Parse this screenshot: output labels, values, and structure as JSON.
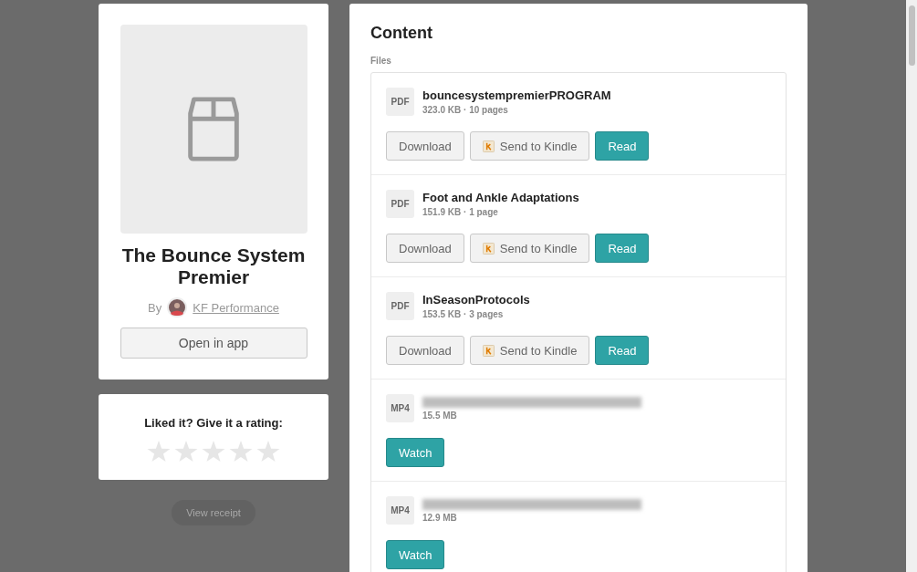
{
  "product": {
    "title": "The Bounce System Premier",
    "by_label": "By",
    "author": "KF Performance",
    "open_button": "Open in app"
  },
  "rating": {
    "prompt": "Liked it? Give it a rating:",
    "stars": 0
  },
  "receipt_button": "View receipt",
  "content": {
    "heading": "Content",
    "section_label": "Files",
    "files": [
      {
        "type": "PDF",
        "kind": "document",
        "redacted": false,
        "title": "bouncesystempremierPROGRAM",
        "meta": "323.0 KB · 10 pages",
        "actions": [
          "Download",
          "Send to Kindle",
          "Read"
        ]
      },
      {
        "type": "PDF",
        "kind": "document",
        "redacted": false,
        "title": "Foot and Ankle Adaptations",
        "meta": "151.9 KB · 1 page",
        "actions": [
          "Download",
          "Send to Kindle",
          "Read"
        ]
      },
      {
        "type": "PDF",
        "kind": "document",
        "redacted": false,
        "title": "InSeasonProtocols",
        "meta": "153.5 KB · 3 pages",
        "actions": [
          "Download",
          "Send to Kindle",
          "Read"
        ]
      },
      {
        "type": "MP4",
        "kind": "video",
        "redacted": true,
        "meta": "15.5 MB",
        "actions": [
          "Watch"
        ]
      },
      {
        "type": "MP4",
        "kind": "video",
        "redacted": true,
        "meta": "12.9 MB",
        "actions": [
          "Watch"
        ]
      }
    ]
  }
}
